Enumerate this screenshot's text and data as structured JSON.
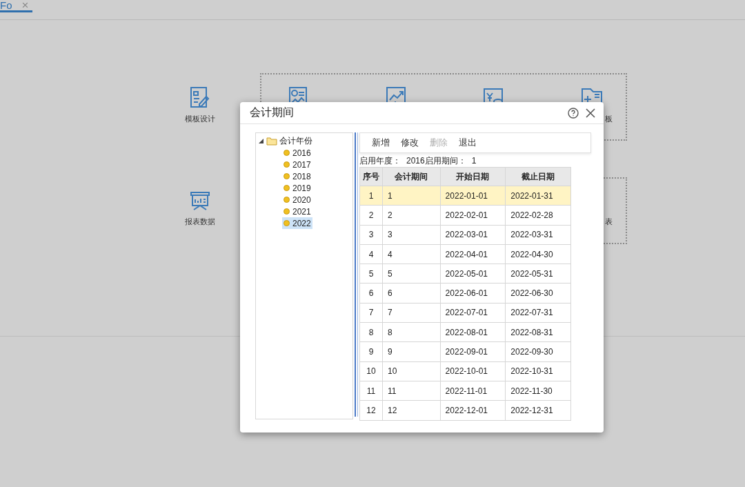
{
  "tab": {
    "label": "Fo",
    "close": "×",
    "selected": true
  },
  "background_items": [
    {
      "kind": "design",
      "label": "模板设计"
    },
    {
      "kind": "money"
    },
    {
      "kind": "chart"
    },
    {
      "kind": "yen"
    },
    {
      "kind": "folder",
      "label": "板"
    }
  ],
  "background_items_row2": [
    {
      "kind": "board",
      "label": "报表数据"
    },
    {
      "kind": "none",
      "label": "表"
    }
  ],
  "dialog": {
    "title": "会计期间",
    "tree": {
      "label": "会计年份",
      "expanded": true,
      "children": [
        {
          "label": "2016",
          "selected": false
        },
        {
          "label": "2017",
          "selected": false
        },
        {
          "label": "2018",
          "selected": false
        },
        {
          "label": "2019",
          "selected": false
        },
        {
          "label": "2020",
          "selected": false
        },
        {
          "label": "2021",
          "selected": false
        },
        {
          "label": "2022",
          "selected": true
        }
      ]
    },
    "toolbar": [
      {
        "label": "新增",
        "disabled": false
      },
      {
        "label": "修改",
        "disabled": false
      },
      {
        "label": "删除",
        "disabled": true
      },
      {
        "label": "退出",
        "disabled": false
      }
    ],
    "info": {
      "start_year_label": "启用年度：",
      "start_year": "2016",
      "start_period_label": "启用期间：",
      "start_period": "1"
    },
    "table": {
      "columns": [
        "序号",
        "会计期间",
        "开始日期",
        "截止日期"
      ],
      "rows": [
        {
          "cells": [
            "1",
            "1",
            "2022-01-01",
            "2022-01-31"
          ],
          "selected": true
        },
        {
          "cells": [
            "2",
            "2",
            "2022-02-01",
            "2022-02-28"
          ],
          "selected": false
        },
        {
          "cells": [
            "3",
            "3",
            "2022-03-01",
            "2022-03-31"
          ],
          "selected": false
        },
        {
          "cells": [
            "4",
            "4",
            "2022-04-01",
            "2022-04-30"
          ],
          "selected": false
        },
        {
          "cells": [
            "5",
            "5",
            "2022-05-01",
            "2022-05-31"
          ],
          "selected": false
        },
        {
          "cells": [
            "6",
            "6",
            "2022-06-01",
            "2022-06-30"
          ],
          "selected": false
        },
        {
          "cells": [
            "7",
            "7",
            "2022-07-01",
            "2022-07-31"
          ],
          "selected": false
        },
        {
          "cells": [
            "8",
            "8",
            "2022-08-01",
            "2022-08-31"
          ],
          "selected": false
        },
        {
          "cells": [
            "9",
            "9",
            "2022-09-01",
            "2022-09-30"
          ],
          "selected": false
        },
        {
          "cells": [
            "10",
            "10",
            "2022-10-01",
            "2022-10-31"
          ],
          "selected": false
        },
        {
          "cells": [
            "11",
            "11",
            "2022-11-01",
            "2022-11-30"
          ],
          "selected": false
        },
        {
          "cells": [
            "12",
            "12",
            "2022-12-01",
            "2022-12-31"
          ],
          "selected": false
        }
      ]
    }
  }
}
